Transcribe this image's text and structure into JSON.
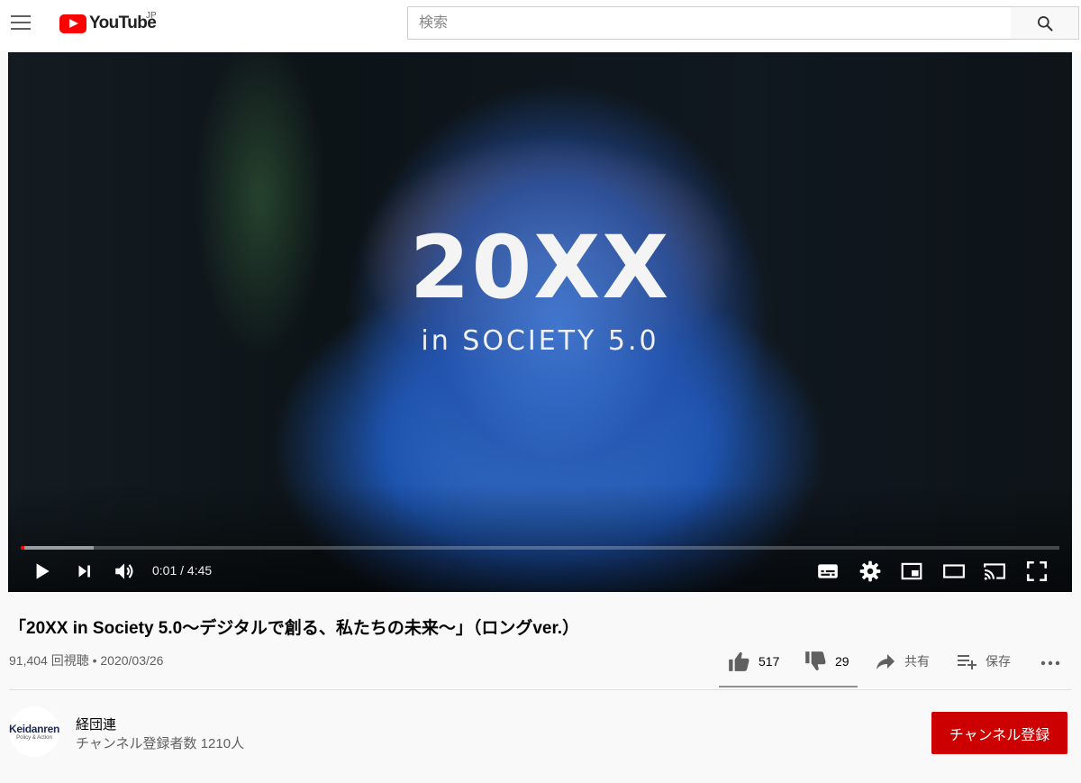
{
  "header": {
    "logo_text": "YouTube",
    "country": "JP",
    "search_placeholder": "検索"
  },
  "player": {
    "overlay_title": "20XX",
    "overlay_subtitle": "in SOCIETY 5.0",
    "time": "0:01 / 4:45",
    "played_fraction": 0.0015,
    "loaded_fraction": 0.07
  },
  "video": {
    "title": "「20XX in Society 5.0～デジタルで創る、私たちの未来～」（ロングver.）",
    "meta": "91,404 回視聴 • 2020/03/26",
    "likes": "517",
    "dislikes": "29",
    "share_label": "共有",
    "save_label": "保存"
  },
  "channel": {
    "avatar_name": "Keidanren",
    "avatar_tagline": "Policy & Action",
    "name": "経団連",
    "subscribers": "チャンネル登録者数 1210人",
    "subscribe_label": "チャンネル登録"
  },
  "colors": {
    "brand_red": "#ff0000",
    "subscribe_red": "#cc0000"
  },
  "icons": [
    "menu-icon",
    "youtube-logo-icon",
    "search-icon",
    "play-icon",
    "next-icon",
    "volume-icon",
    "subtitles-icon",
    "settings-icon",
    "miniplayer-icon",
    "theater-icon",
    "cast-icon",
    "fullscreen-icon",
    "like-icon",
    "dislike-icon",
    "share-icon",
    "save-icon",
    "more-icon"
  ]
}
